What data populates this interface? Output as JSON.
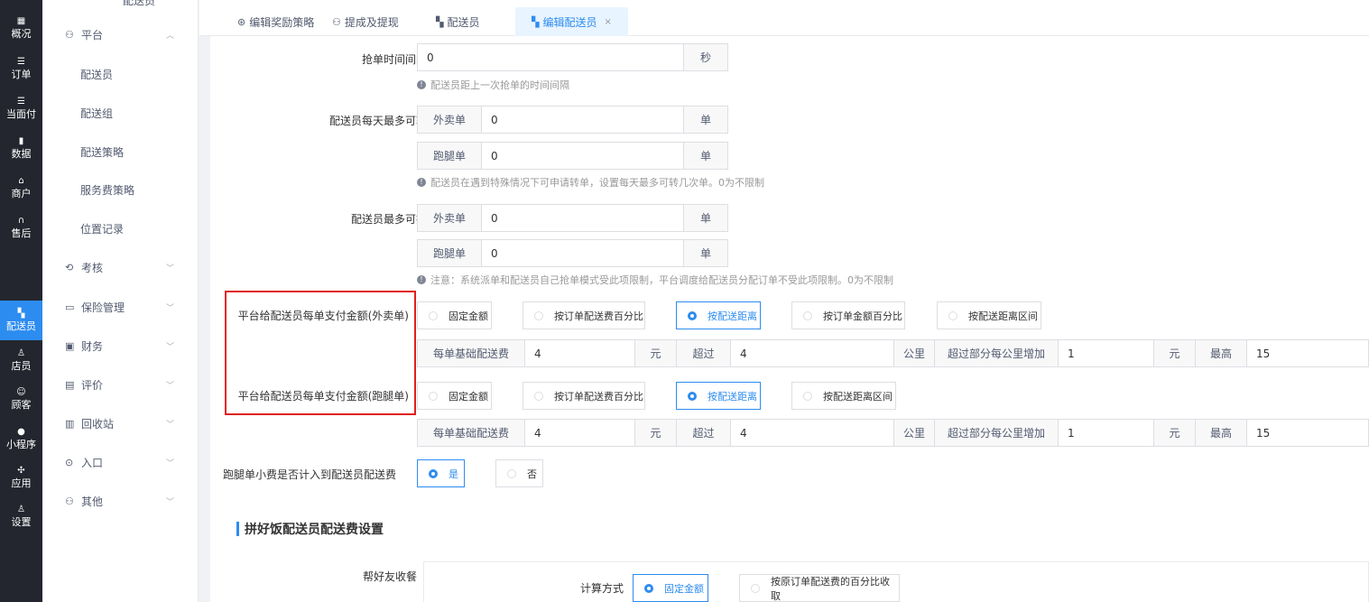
{
  "nav": [
    {
      "label": "概况",
      "icon": "dashboard-icon",
      "glyph": "▦"
    },
    {
      "label": "订单",
      "icon": "list-icon",
      "glyph": "☰"
    },
    {
      "label": "当面付",
      "icon": "list-icon",
      "glyph": "☰"
    },
    {
      "label": "数据",
      "icon": "bar-chart-icon",
      "glyph": "▮"
    },
    {
      "label": "商户",
      "icon": "store-icon",
      "glyph": "⌂"
    },
    {
      "label": "售后",
      "icon": "headset-icon",
      "glyph": "∩"
    },
    {
      "label": "配送员",
      "icon": "scooter-icon",
      "glyph": "▚"
    },
    {
      "label": "店员",
      "icon": "users-icon",
      "glyph": "♙"
    },
    {
      "label": "顾客",
      "icon": "user-circle-icon",
      "glyph": "☺"
    },
    {
      "label": "小程序",
      "icon": "wechat-icon",
      "glyph": "●"
    },
    {
      "label": "应用",
      "icon": "apps-icon",
      "glyph": "✣"
    },
    {
      "label": "设置",
      "icon": "user-settings-icon",
      "glyph": "♙"
    }
  ],
  "submenu": {
    "top_cut": "配送员",
    "groups": [
      {
        "label": "平台",
        "glyph": "⚇",
        "chev": "︿"
      },
      {
        "label": "考核",
        "glyph": "⟲",
        "chev": "﹀"
      },
      {
        "label": "保险管理",
        "glyph": "▭",
        "chev": "﹀"
      },
      {
        "label": "财务",
        "glyph": "▣",
        "chev": "﹀"
      },
      {
        "label": "评价",
        "glyph": "▤",
        "chev": "﹀"
      },
      {
        "label": "回收站",
        "glyph": "▥",
        "chev": "﹀"
      },
      {
        "label": "入口",
        "glyph": "⊙",
        "chev": "﹀"
      },
      {
        "label": "其他",
        "glyph": "⚇",
        "chev": "﹀"
      }
    ],
    "items": [
      "配送员",
      "配送组",
      "配送策略",
      "服务费策略",
      "位置记录"
    ]
  },
  "tabs": [
    {
      "label": "编辑奖励策略",
      "glyph": "⊛"
    },
    {
      "label": "提成及提现",
      "glyph": "⚇"
    },
    {
      "label": "配送员",
      "glyph": "▚"
    },
    {
      "label": "编辑配送员",
      "glyph": "▚",
      "close": "×"
    }
  ],
  "form": {
    "grab_interval": {
      "label": "抢单时间间隔",
      "value": "0",
      "unit": "秒",
      "hint": "配送员距上一次抢单的时间间隔"
    },
    "max_transfer": {
      "label": "配送员每天最多可转",
      "takeout": {
        "tag": "外卖单",
        "value": "0",
        "unit": "单"
      },
      "errand": {
        "tag": "跑腿单",
        "value": "0",
        "unit": "单"
      },
      "hint": "配送员在遇到特殊情况下可申请转单，设置每天最多可转几次单。0为不限制"
    },
    "max_grab": {
      "label": "配送员最多可抢",
      "takeout": {
        "tag": "外卖单",
        "value": "0",
        "unit": "单"
      },
      "errand": {
        "tag": "跑腿单",
        "value": "0",
        "unit": "单"
      },
      "hint": "注意：系统派单和配送员自己抢单模式受此项限制，平台调度给配送员分配订单不受此项限制。0为不限制"
    },
    "pay_takeout": {
      "label": "平台给配送员每单支付金额(外卖单)",
      "options": [
        "固定金额",
        "按订单配送费百分比",
        "按配送距离",
        "按订单金额百分比",
        "按配送距离区间"
      ],
      "selected": 2
    },
    "pay_errand": {
      "label": "平台给配送员每单支付金额(跑腿单)",
      "options": [
        "固定金额",
        "按订单配送费百分比",
        "按配送距离",
        "按配送距离区间"
      ],
      "selected": 2
    },
    "distance_row_1": {
      "base_label": "每单基础配送费",
      "base": "4",
      "yuan": "元",
      "over_label": "超过",
      "over": "4",
      "km": "公里",
      "add_label": "超过部分每公里增加",
      "add": "1",
      "yuan2": "元",
      "max_label": "最高",
      "max": "15"
    },
    "distance_row_2": {
      "base_label": "每单基础配送费",
      "base": "4",
      "yuan": "元",
      "over_label": "超过",
      "over": "4",
      "km": "公里",
      "add_label": "超过部分每公里增加",
      "add": "1",
      "yuan2": "元",
      "max_label": "最高",
      "max": "15"
    },
    "tip_included": {
      "label": "跑腿单小费是否计入到配送员配送费",
      "options": [
        "是",
        "否"
      ],
      "selected": 0
    }
  },
  "pinhao": {
    "section_title": "拼好饭配送员配送费设置",
    "help_label": "帮好友收餐",
    "calc_label": "计算方式",
    "options": [
      "固定金额",
      "按原订单配送费的百分比收取"
    ],
    "selected": 0
  },
  "colors": {
    "accent": "#2d8cf0",
    "nav_bg": "#23262e",
    "highlight_box": "#e0201b"
  }
}
